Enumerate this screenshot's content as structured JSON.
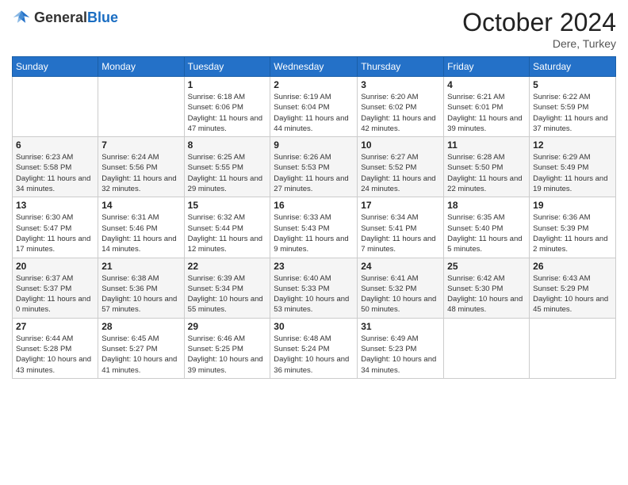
{
  "header": {
    "logo": {
      "text_general": "General",
      "text_blue": "Blue"
    },
    "title": "October 2024",
    "location": "Dere, Turkey"
  },
  "weekdays": [
    "Sunday",
    "Monday",
    "Tuesday",
    "Wednesday",
    "Thursday",
    "Friday",
    "Saturday"
  ],
  "weeks": [
    [
      {
        "day": "",
        "sunrise": "",
        "sunset": "",
        "daylight": ""
      },
      {
        "day": "",
        "sunrise": "",
        "sunset": "",
        "daylight": ""
      },
      {
        "day": "1",
        "sunrise": "Sunrise: 6:18 AM",
        "sunset": "Sunset: 6:06 PM",
        "daylight": "Daylight: 11 hours and 47 minutes."
      },
      {
        "day": "2",
        "sunrise": "Sunrise: 6:19 AM",
        "sunset": "Sunset: 6:04 PM",
        "daylight": "Daylight: 11 hours and 44 minutes."
      },
      {
        "day": "3",
        "sunrise": "Sunrise: 6:20 AM",
        "sunset": "Sunset: 6:02 PM",
        "daylight": "Daylight: 11 hours and 42 minutes."
      },
      {
        "day": "4",
        "sunrise": "Sunrise: 6:21 AM",
        "sunset": "Sunset: 6:01 PM",
        "daylight": "Daylight: 11 hours and 39 minutes."
      },
      {
        "day": "5",
        "sunrise": "Sunrise: 6:22 AM",
        "sunset": "Sunset: 5:59 PM",
        "daylight": "Daylight: 11 hours and 37 minutes."
      }
    ],
    [
      {
        "day": "6",
        "sunrise": "Sunrise: 6:23 AM",
        "sunset": "Sunset: 5:58 PM",
        "daylight": "Daylight: 11 hours and 34 minutes."
      },
      {
        "day": "7",
        "sunrise": "Sunrise: 6:24 AM",
        "sunset": "Sunset: 5:56 PM",
        "daylight": "Daylight: 11 hours and 32 minutes."
      },
      {
        "day": "8",
        "sunrise": "Sunrise: 6:25 AM",
        "sunset": "Sunset: 5:55 PM",
        "daylight": "Daylight: 11 hours and 29 minutes."
      },
      {
        "day": "9",
        "sunrise": "Sunrise: 6:26 AM",
        "sunset": "Sunset: 5:53 PM",
        "daylight": "Daylight: 11 hours and 27 minutes."
      },
      {
        "day": "10",
        "sunrise": "Sunrise: 6:27 AM",
        "sunset": "Sunset: 5:52 PM",
        "daylight": "Daylight: 11 hours and 24 minutes."
      },
      {
        "day": "11",
        "sunrise": "Sunrise: 6:28 AM",
        "sunset": "Sunset: 5:50 PM",
        "daylight": "Daylight: 11 hours and 22 minutes."
      },
      {
        "day": "12",
        "sunrise": "Sunrise: 6:29 AM",
        "sunset": "Sunset: 5:49 PM",
        "daylight": "Daylight: 11 hours and 19 minutes."
      }
    ],
    [
      {
        "day": "13",
        "sunrise": "Sunrise: 6:30 AM",
        "sunset": "Sunset: 5:47 PM",
        "daylight": "Daylight: 11 hours and 17 minutes."
      },
      {
        "day": "14",
        "sunrise": "Sunrise: 6:31 AM",
        "sunset": "Sunset: 5:46 PM",
        "daylight": "Daylight: 11 hours and 14 minutes."
      },
      {
        "day": "15",
        "sunrise": "Sunrise: 6:32 AM",
        "sunset": "Sunset: 5:44 PM",
        "daylight": "Daylight: 11 hours and 12 minutes."
      },
      {
        "day": "16",
        "sunrise": "Sunrise: 6:33 AM",
        "sunset": "Sunset: 5:43 PM",
        "daylight": "Daylight: 11 hours and 9 minutes."
      },
      {
        "day": "17",
        "sunrise": "Sunrise: 6:34 AM",
        "sunset": "Sunset: 5:41 PM",
        "daylight": "Daylight: 11 hours and 7 minutes."
      },
      {
        "day": "18",
        "sunrise": "Sunrise: 6:35 AM",
        "sunset": "Sunset: 5:40 PM",
        "daylight": "Daylight: 11 hours and 5 minutes."
      },
      {
        "day": "19",
        "sunrise": "Sunrise: 6:36 AM",
        "sunset": "Sunset: 5:39 PM",
        "daylight": "Daylight: 11 hours and 2 minutes."
      }
    ],
    [
      {
        "day": "20",
        "sunrise": "Sunrise: 6:37 AM",
        "sunset": "Sunset: 5:37 PM",
        "daylight": "Daylight: 11 hours and 0 minutes."
      },
      {
        "day": "21",
        "sunrise": "Sunrise: 6:38 AM",
        "sunset": "Sunset: 5:36 PM",
        "daylight": "Daylight: 10 hours and 57 minutes."
      },
      {
        "day": "22",
        "sunrise": "Sunrise: 6:39 AM",
        "sunset": "Sunset: 5:34 PM",
        "daylight": "Daylight: 10 hours and 55 minutes."
      },
      {
        "day": "23",
        "sunrise": "Sunrise: 6:40 AM",
        "sunset": "Sunset: 5:33 PM",
        "daylight": "Daylight: 10 hours and 53 minutes."
      },
      {
        "day": "24",
        "sunrise": "Sunrise: 6:41 AM",
        "sunset": "Sunset: 5:32 PM",
        "daylight": "Daylight: 10 hours and 50 minutes."
      },
      {
        "day": "25",
        "sunrise": "Sunrise: 6:42 AM",
        "sunset": "Sunset: 5:30 PM",
        "daylight": "Daylight: 10 hours and 48 minutes."
      },
      {
        "day": "26",
        "sunrise": "Sunrise: 6:43 AM",
        "sunset": "Sunset: 5:29 PM",
        "daylight": "Daylight: 10 hours and 45 minutes."
      }
    ],
    [
      {
        "day": "27",
        "sunrise": "Sunrise: 6:44 AM",
        "sunset": "Sunset: 5:28 PM",
        "daylight": "Daylight: 10 hours and 43 minutes."
      },
      {
        "day": "28",
        "sunrise": "Sunrise: 6:45 AM",
        "sunset": "Sunset: 5:27 PM",
        "daylight": "Daylight: 10 hours and 41 minutes."
      },
      {
        "day": "29",
        "sunrise": "Sunrise: 6:46 AM",
        "sunset": "Sunset: 5:25 PM",
        "daylight": "Daylight: 10 hours and 39 minutes."
      },
      {
        "day": "30",
        "sunrise": "Sunrise: 6:48 AM",
        "sunset": "Sunset: 5:24 PM",
        "daylight": "Daylight: 10 hours and 36 minutes."
      },
      {
        "day": "31",
        "sunrise": "Sunrise: 6:49 AM",
        "sunset": "Sunset: 5:23 PM",
        "daylight": "Daylight: 10 hours and 34 minutes."
      },
      {
        "day": "",
        "sunrise": "",
        "sunset": "",
        "daylight": ""
      },
      {
        "day": "",
        "sunrise": "",
        "sunset": "",
        "daylight": ""
      }
    ]
  ]
}
